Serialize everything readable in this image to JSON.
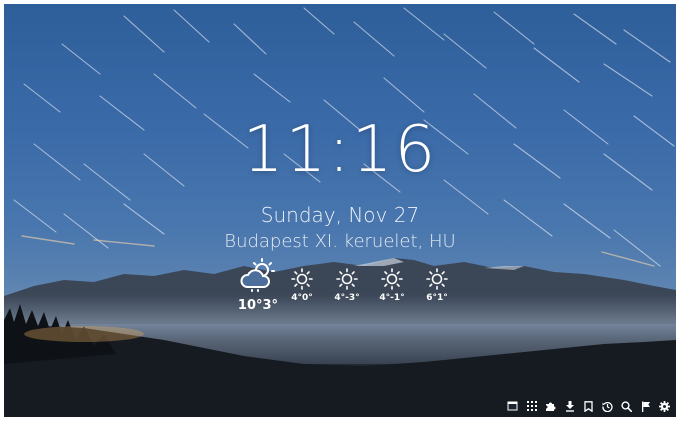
{
  "clock": {
    "time": "11:16"
  },
  "date": {
    "text": "Sunday, Nov 27"
  },
  "location": {
    "text": "Budapest XI. keruelet, HU"
  },
  "weather": {
    "today": {
      "icon": "partly-cloudy-icon",
      "temp": "10°3°"
    },
    "forecast": [
      {
        "icon": "sun-icon",
        "temp": "4°0°"
      },
      {
        "icon": "sun-icon",
        "temp": "4°-3°"
      },
      {
        "icon": "sun-icon",
        "temp": "4°-1°"
      },
      {
        "icon": "sun-icon",
        "temp": "6°1°"
      }
    ]
  },
  "toolbar": {
    "icons": [
      "tab-icon",
      "apps-grid-icon",
      "puzzle-icon",
      "download-icon",
      "bookmark-icon",
      "history-icon",
      "search-icon",
      "flag-icon",
      "gear-icon"
    ]
  },
  "colors": {
    "sky_top": "#2f5f9a",
    "sky_mid": "#4a77ae",
    "foreground_dark": "#11161c",
    "text": "#ffffff"
  }
}
